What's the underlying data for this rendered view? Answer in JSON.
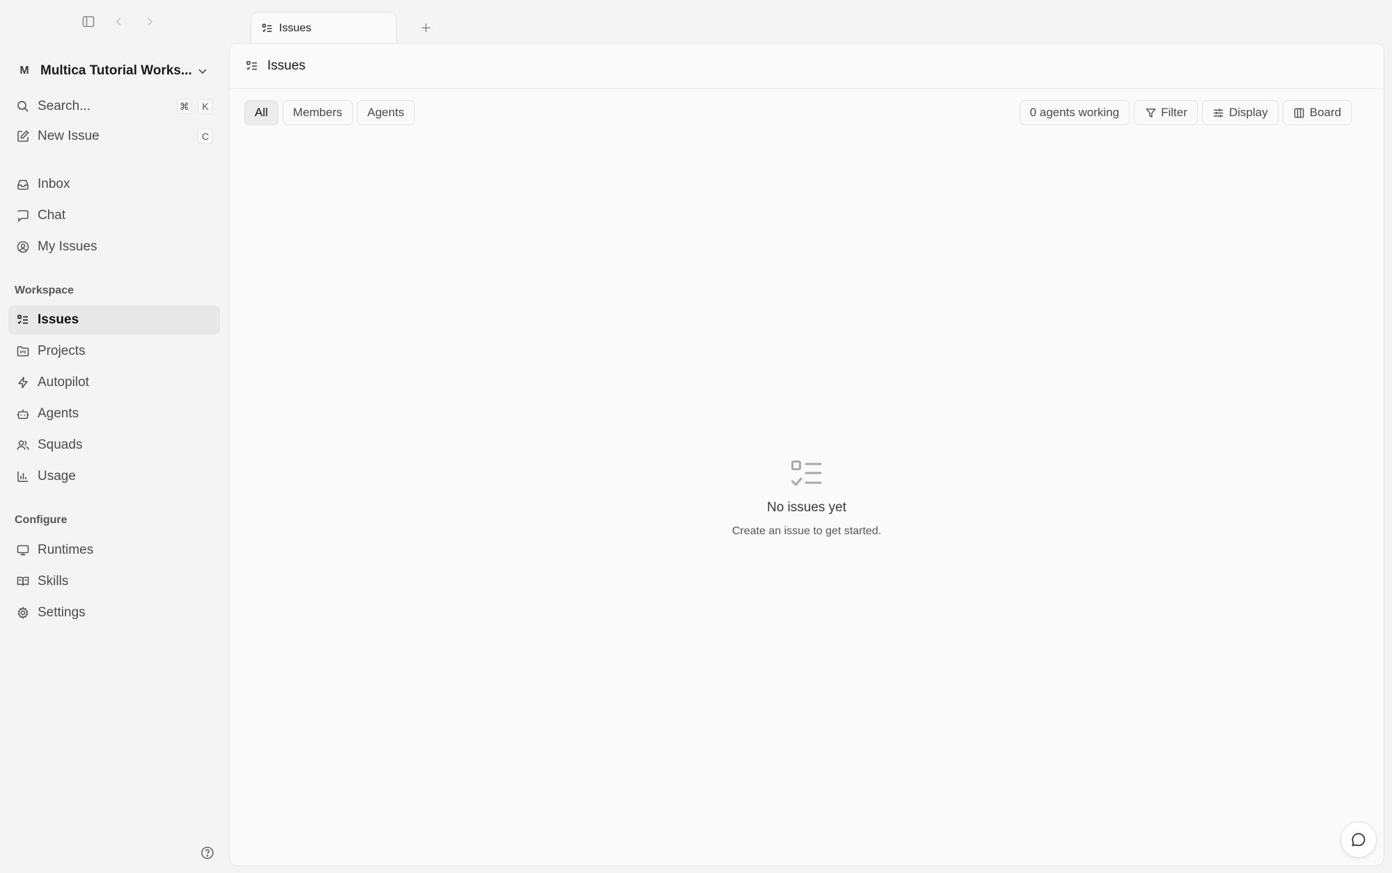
{
  "sidebar": {
    "top_icons": [
      "sidebar-toggle-icon",
      "back-icon",
      "forward-icon"
    ],
    "workspace": {
      "avatar": "M",
      "name": "Multica Tutorial Works..."
    },
    "search": {
      "label": "Search...",
      "shortcut": [
        "⌘",
        "K"
      ]
    },
    "new_issue": {
      "label": "New Issue",
      "shortcut": "C"
    },
    "personal": [
      {
        "label": "Inbox",
        "icon": "inbox-icon"
      },
      {
        "label": "Chat",
        "icon": "chat-icon"
      },
      {
        "label": "My Issues",
        "icon": "user-circle-icon"
      }
    ],
    "workspace_section": {
      "title": "Workspace",
      "items": [
        {
          "label": "Issues",
          "icon": "issues-list-icon",
          "active": true
        },
        {
          "label": "Projects",
          "icon": "projects-icon"
        },
        {
          "label": "Autopilot",
          "icon": "lightning-icon"
        },
        {
          "label": "Agents",
          "icon": "bot-icon"
        },
        {
          "label": "Squads",
          "icon": "users-icon"
        },
        {
          "label": "Usage",
          "icon": "bar-chart-icon"
        }
      ]
    },
    "configure_section": {
      "title": "Configure",
      "items": [
        {
          "label": "Runtimes",
          "icon": "monitor-icon"
        },
        {
          "label": "Skills",
          "icon": "book-icon"
        },
        {
          "label": "Settings",
          "icon": "gear-icon"
        }
      ]
    }
  },
  "tabs": [
    {
      "label": "Issues",
      "icon": "issues-list-icon"
    }
  ],
  "main": {
    "title": "Issues",
    "filters": [
      "All",
      "Members",
      "Agents"
    ],
    "active_filter": "All",
    "agents_working": "0 agents working",
    "filter_label": "Filter",
    "display_label": "Display",
    "board_label": "Board",
    "empty": {
      "title": "No issues yet",
      "subtitle": "Create an issue to get started."
    }
  },
  "colors": {
    "sidebar_bg": "#f4f4f4",
    "panel_bg": "#fafafa",
    "active_bg": "#e8e8e8",
    "border": "#e6e6e6"
  }
}
